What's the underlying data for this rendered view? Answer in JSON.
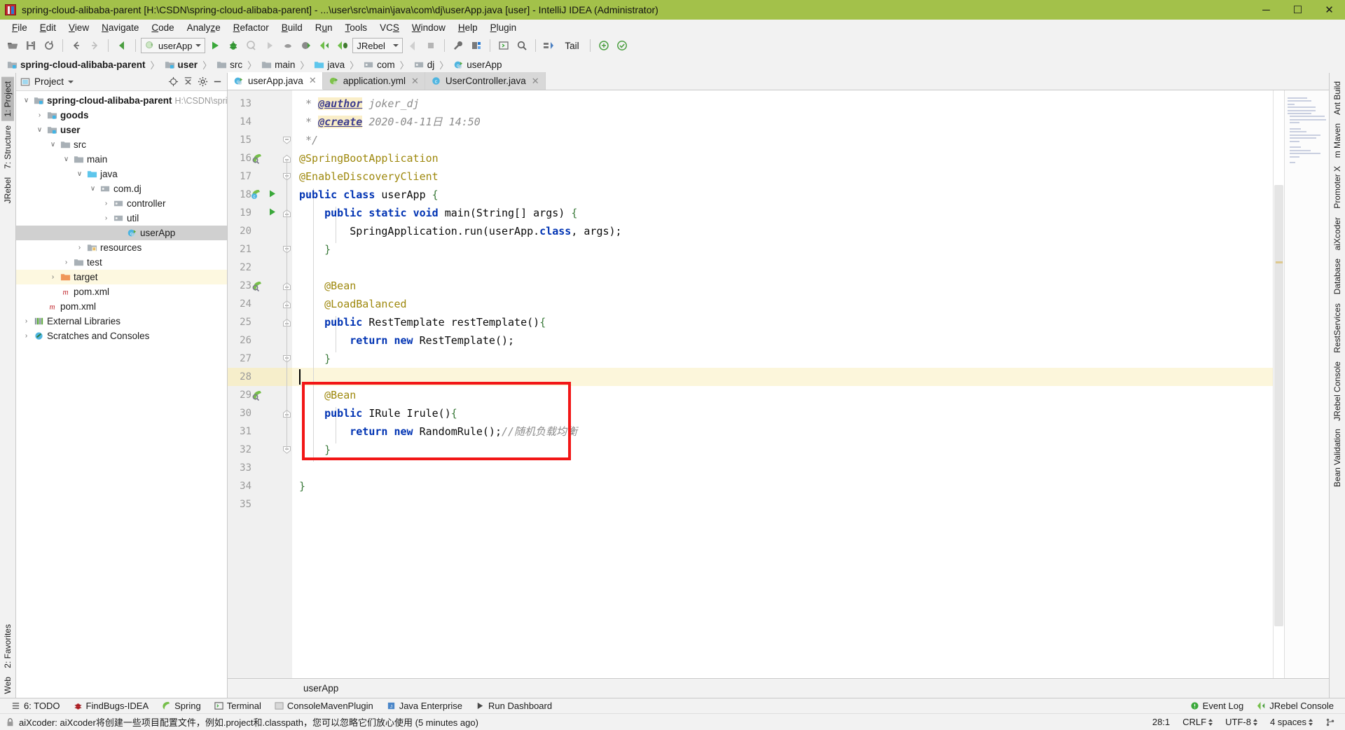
{
  "window": {
    "title": "spring-cloud-alibaba-parent [H:\\CSDN\\spring-cloud-alibaba-parent] - ...\\user\\src\\main\\java\\com\\dj\\userApp.java [user] - IntelliJ IDEA (Administrator)",
    "minimize": "─",
    "maximize": "☐",
    "close": "✕"
  },
  "menu": {
    "items": [
      {
        "label": "File",
        "mnemonic": "F"
      },
      {
        "label": "Edit",
        "mnemonic": "E"
      },
      {
        "label": "View",
        "mnemonic": "V"
      },
      {
        "label": "Navigate",
        "mnemonic": "N"
      },
      {
        "label": "Code",
        "mnemonic": "C"
      },
      {
        "label": "Analyze",
        "mnemonic": "z"
      },
      {
        "label": "Refactor",
        "mnemonic": "R"
      },
      {
        "label": "Build",
        "mnemonic": "B"
      },
      {
        "label": "Run",
        "mnemonic": "u"
      },
      {
        "label": "Tools",
        "mnemonic": "T"
      },
      {
        "label": "VCS",
        "mnemonic": "S"
      },
      {
        "label": "Window",
        "mnemonic": "W"
      },
      {
        "label": "Help",
        "mnemonic": "H"
      },
      {
        "label": "Plugin",
        "mnemonic": "P"
      }
    ]
  },
  "toolbar": {
    "run_config": "userApp",
    "jrebel_config": "JRebel",
    "tail_label": "Tail",
    "icons": [
      "open-folder-icon",
      "save-all-icon",
      "sync-icon",
      "back-arrow-icon",
      "forward-arrow-icon",
      "undo-icon",
      "run-icon",
      "debug-icon",
      "run-with-coverage-icon",
      "run-dashboard-icon",
      "profiler-icon",
      "jrebel-run-icon",
      "jrebel-debug-icon",
      "jrebel-debug2-icon",
      "build-icon",
      "stop-icon",
      "settings-wrench-icon",
      "project-structure-icon",
      "terminal-icon",
      "search-everywhere-icon",
      "update-project-icon",
      "commit-icon",
      "checkmark-icon"
    ]
  },
  "breadcrumb": {
    "items": [
      {
        "label": "spring-cloud-alibaba-parent",
        "icon": "module-folder-icon",
        "bold": true
      },
      {
        "label": "user",
        "icon": "module-folder-icon",
        "bold": true
      },
      {
        "label": "src",
        "icon": "folder-icon",
        "bold": false
      },
      {
        "label": "main",
        "icon": "folder-icon",
        "bold": false
      },
      {
        "label": "java",
        "icon": "source-folder-icon",
        "bold": false
      },
      {
        "label": "com",
        "icon": "package-icon",
        "bold": false
      },
      {
        "label": "dj",
        "icon": "package-icon",
        "bold": false
      },
      {
        "label": "userApp",
        "icon": "java-class-icon",
        "bold": false
      }
    ],
    "separator": "〉"
  },
  "left_rail": {
    "tabs": [
      {
        "label": "1: Project",
        "active": true
      },
      {
        "label": "7: Structure",
        "active": false
      },
      {
        "label": "JRebel",
        "active": false
      },
      {
        "label": "2: Favorites",
        "active": false
      },
      {
        "label": "Web",
        "active": false
      }
    ]
  },
  "right_rail": {
    "tabs": [
      {
        "label": "Ant Build"
      },
      {
        "label": "m Maven"
      },
      {
        "label": "Promoter X"
      },
      {
        "label": "aiXcoder"
      },
      {
        "label": "Database"
      },
      {
        "label": "RestServices"
      },
      {
        "label": "JRebel Console"
      },
      {
        "label": "Bean Validation"
      }
    ]
  },
  "project_panel": {
    "title": "Project",
    "header_icons": [
      "locate-icon",
      "collapse-all-icon",
      "settings-gear-icon",
      "hide-icon"
    ],
    "tree": [
      {
        "label": "spring-cloud-alibaba-parent",
        "suffix": "H:\\CSDN\\sprin",
        "indent": 0,
        "arrow": "down",
        "icon": "module-folder-icon",
        "bold": true,
        "state": "normal"
      },
      {
        "label": "goods",
        "indent": 1,
        "arrow": "right",
        "icon": "module-folder-icon",
        "bold": true,
        "state": "normal"
      },
      {
        "label": "user",
        "indent": 1,
        "arrow": "down",
        "icon": "module-folder-icon",
        "bold": true,
        "state": "normal"
      },
      {
        "label": "src",
        "indent": 2,
        "arrow": "down",
        "icon": "folder-icon",
        "bold": false,
        "state": "normal"
      },
      {
        "label": "main",
        "indent": 3,
        "arrow": "down",
        "icon": "folder-icon",
        "bold": false,
        "state": "normal"
      },
      {
        "label": "java",
        "indent": 4,
        "arrow": "down",
        "icon": "source-folder-icon",
        "bold": false,
        "state": "normal"
      },
      {
        "label": "com.dj",
        "indent": 5,
        "arrow": "down",
        "icon": "package-icon",
        "bold": false,
        "state": "normal"
      },
      {
        "label": "controller",
        "indent": 6,
        "arrow": "right",
        "icon": "package-icon",
        "bold": false,
        "state": "normal"
      },
      {
        "label": "util",
        "indent": 6,
        "arrow": "right",
        "icon": "package-icon",
        "bold": false,
        "state": "normal"
      },
      {
        "label": "userApp",
        "indent": 7,
        "arrow": "none",
        "icon": "java-class-icon",
        "bold": false,
        "state": "selected"
      },
      {
        "label": "resources",
        "indent": 4,
        "arrow": "right",
        "icon": "resources-folder-icon",
        "bold": false,
        "state": "normal"
      },
      {
        "label": "test",
        "indent": 3,
        "arrow": "right",
        "icon": "folder-icon",
        "bold": false,
        "state": "normal"
      },
      {
        "label": "target",
        "indent": 2,
        "arrow": "right",
        "icon": "target-folder-icon",
        "bold": false,
        "state": "highlight"
      },
      {
        "label": "pom.xml",
        "indent": 2,
        "arrow": "none",
        "icon": "maven-icon",
        "bold": false,
        "state": "normal"
      },
      {
        "label": "pom.xml",
        "indent": 1,
        "arrow": "none",
        "icon": "maven-icon",
        "bold": false,
        "state": "normal"
      },
      {
        "label": "External Libraries",
        "indent": 0,
        "arrow": "right",
        "icon": "libraries-icon",
        "bold": false,
        "state": "normal"
      },
      {
        "label": "Scratches and Consoles",
        "indent": 0,
        "arrow": "right",
        "icon": "scratches-icon",
        "bold": false,
        "state": "normal"
      }
    ]
  },
  "editor": {
    "tabs": [
      {
        "label": "userApp.java",
        "icon": "java-class-icon",
        "active": true,
        "close": "✕"
      },
      {
        "label": "application.yml",
        "icon": "yml-icon",
        "active": false,
        "close": "✕"
      },
      {
        "label": "UserController.java",
        "icon": "java-class-blue-icon",
        "active": false,
        "close": "✕"
      }
    ],
    "breadcrumb_footer": "userApp",
    "first_line_number": 13,
    "lines": [
      {
        "n": 13,
        "text": " * @author joker_dj",
        "kind": "javadoc",
        "tag": "@author"
      },
      {
        "n": 14,
        "text": " * @create 2020-04-11日 14:50",
        "kind": "javadoc",
        "tag": "@create"
      },
      {
        "n": 15,
        "text": " */",
        "kind": "javadoc"
      },
      {
        "n": 16,
        "text": "@SpringBootApplication",
        "kind": "annotation"
      },
      {
        "n": 17,
        "text": "@EnableDiscoveryClient",
        "kind": "annotation"
      },
      {
        "n": 18,
        "text": "public class userApp {",
        "kind": "code"
      },
      {
        "n": 19,
        "text": "    public static void main(String[] args) {",
        "kind": "code"
      },
      {
        "n": 20,
        "text": "        SpringApplication.run(userApp.class, args);",
        "kind": "code"
      },
      {
        "n": 21,
        "text": "    }",
        "kind": "code"
      },
      {
        "n": 22,
        "text": "",
        "kind": "code"
      },
      {
        "n": 23,
        "text": "    @Bean",
        "kind": "annotation"
      },
      {
        "n": 24,
        "text": "    @LoadBalanced",
        "kind": "annotation"
      },
      {
        "n": 25,
        "text": "    public RestTemplate restTemplate(){",
        "kind": "code"
      },
      {
        "n": 26,
        "text": "        return new RestTemplate();",
        "kind": "code"
      },
      {
        "n": 27,
        "text": "    }",
        "kind": "code"
      },
      {
        "n": 28,
        "text": "",
        "kind": "code",
        "current": true
      },
      {
        "n": 29,
        "text": "    @Bean",
        "kind": "annotation"
      },
      {
        "n": 30,
        "text": "    public IRule Irule(){",
        "kind": "code"
      },
      {
        "n": 31,
        "text": "        return new RandomRule();//随机负载均衡",
        "kind": "code"
      },
      {
        "n": 32,
        "text": "    }",
        "kind": "code"
      },
      {
        "n": 33,
        "text": "",
        "kind": "code"
      },
      {
        "n": 34,
        "text": "}",
        "kind": "code"
      },
      {
        "n": 35,
        "text": "",
        "kind": "code"
      }
    ]
  },
  "toolwindow_bar": {
    "items": [
      {
        "label": "6: TODO",
        "icon": "todo-icon"
      },
      {
        "label": "FindBugs-IDEA",
        "icon": "findbugs-icon"
      },
      {
        "label": "Spring",
        "icon": "spring-icon"
      },
      {
        "label": "Terminal",
        "icon": "terminal-icon"
      },
      {
        "label": "ConsoleMavenPlugin",
        "icon": "maven-console-icon"
      },
      {
        "label": "Java Enterprise",
        "icon": "java-enterprise-icon"
      },
      {
        "label": "Run Dashboard",
        "icon": "run-dashboard-icon"
      }
    ],
    "right_items": [
      {
        "label": "Event Log",
        "icon": "event-log-icon"
      },
      {
        "label": "JRebel Console",
        "icon": "jrebel-icon"
      }
    ]
  },
  "statusbar": {
    "message": "aiXcoder: aiXcoder将创建一些项目配置文件，例如.project和.classpath，您可以忽略它们放心使用 (5 minutes ago)",
    "lock_icon": "lock-icon",
    "position": "28:1",
    "line_separator": "CRLF",
    "encoding": "UTF-8",
    "indent": "4 spaces",
    "branch_icon": "git-branch-icon"
  },
  "colors": {
    "titlebar_bg": "#a3c14a",
    "chrome_bg": "#f2f2f2",
    "editor_bg": "#ffffff",
    "selection_bg": "#d0d0d0",
    "highlight_row": "#fdf8e0",
    "caret_line": "#fcf6db",
    "redbox": "#f21616",
    "keyword": "#0033b3",
    "annotation": "#9e880d",
    "comment": "#8c8c8c",
    "accent_green": "#4a9e3f"
  }
}
